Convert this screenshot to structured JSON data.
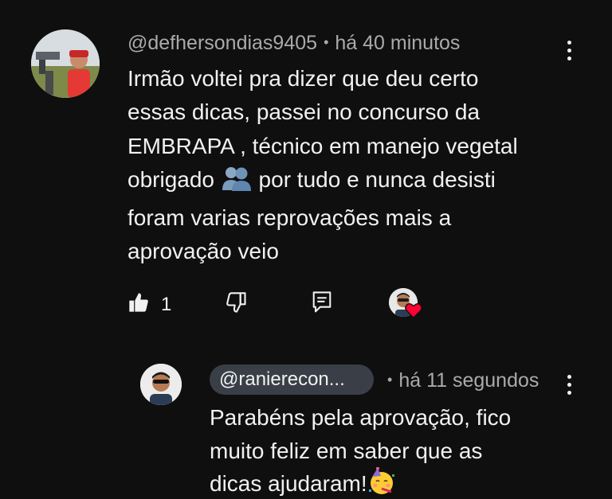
{
  "comment": {
    "author": "@defhersondias9405",
    "time": "há 40 minutos",
    "lines": [
      "Irmão voltei pra dizer que deu certo",
      "essas dicas, passei no concurso da",
      "EMBRAPA , técnico em manejo vegetal",
      "obrigado",
      "por tudo e nunca desisti",
      "foram varias reprovações mais a",
      "aprovação veio"
    ],
    "emoji": "busts-in-silhouette",
    "like_count": "1"
  },
  "reply": {
    "author": "@ranierecon...",
    "time": "há 11 segundos",
    "lines": [
      "Parabéns pela aprovação, fico",
      "muito feliz em saber que as",
      "dicas ajudaram!"
    ],
    "emoji": "partying-face"
  },
  "colors": {
    "background": "#0f0f0f",
    "text": "#f1f1f1",
    "meta": "#aaaaaa",
    "chip": "#3a3f47",
    "heart": "#ff0033"
  }
}
